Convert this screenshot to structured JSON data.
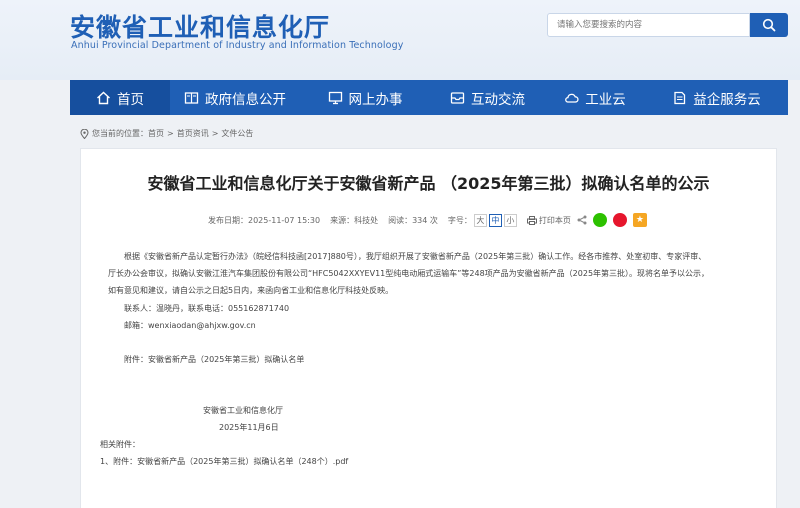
{
  "header": {
    "logo_cn": "安徽省工业和信息化厅",
    "logo_en": "Anhui Provincial Department of Industry and Information Technology",
    "search_placeholder": "请输入您要搜索的内容"
  },
  "nav": {
    "items": [
      {
        "label": "首页",
        "icon": "home-icon"
      },
      {
        "label": "政府信息公开",
        "icon": "book-icon"
      },
      {
        "label": "网上办事",
        "icon": "monitor-icon"
      },
      {
        "label": "互动交流",
        "icon": "inbox-icon"
      },
      {
        "label": "工业云",
        "icon": "cloud-icon"
      },
      {
        "label": "益企服务云",
        "icon": "document-icon"
      }
    ]
  },
  "breadcrumb": {
    "prefix": "您当前的位置：",
    "items": [
      "首页",
      "首页资讯",
      "文件公告"
    ],
    "sep": ">"
  },
  "article": {
    "title": "安徽省工业和信息化厅关于安徽省新产品 （2025年第三批）拟确认名单的公示",
    "meta": {
      "date": "发布日期：2025-11-07 15:30",
      "source": "来源：科技处",
      "views": "阅读：334 次",
      "font_label": "字号：",
      "font_sizes": [
        "大",
        "中",
        "小"
      ],
      "print": "打印本页"
    },
    "lines": [
      "根据《安徽省新产品认定暂行办法》（皖经信科技函[2017]880号），我厅组织开展了安徽省新产品（2025年第三批）确认工作。经各市推荐、处室初审、专家评审、",
      "厅长办公会审议，拟确认安徽江淮汽车集团股份有限公司“HFC5042XXYEV11型纯电动厢式运输车”等248项产品为安徽省新产品（2025年第三批）。现将名单予以公示，",
      "如有意见和建议，请自公示之日起5日内，来函向省工业和信息化厅科技处反映。"
    ],
    "contact": "联系人：温晓丹，联系电话：055162871740",
    "email": "邮箱：wenxiaodan@ahjxw.gov.cn",
    "attachment_note": "附件：安徽省新产品（2025年第三批）拟确认名单",
    "sign_org": "安徽省工业和信息化厅",
    "sign_date": "2025年11月6日",
    "related_label": "相关附件：",
    "related_file": "1、附件：安徽省新产品（2025年第三批）拟确认名单（248个）.pdf"
  },
  "colors": {
    "brand": "#1f5fb5",
    "wechat": "#2dc100",
    "weibo": "#e6162d",
    "favorite": "#f5a623"
  }
}
